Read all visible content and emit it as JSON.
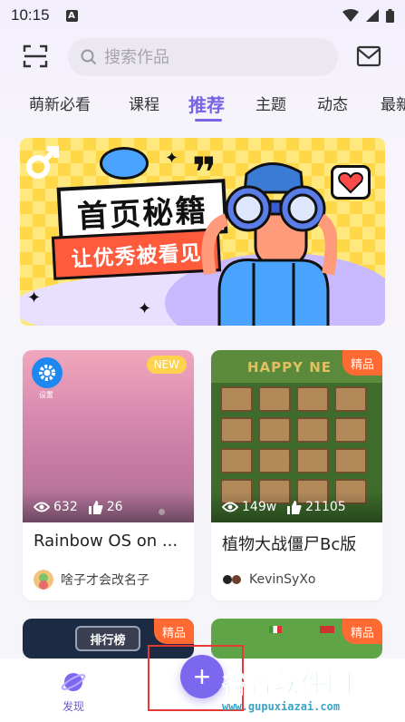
{
  "status_bar": {
    "time": "10:15",
    "indicator": "A",
    "icons": [
      "wifi-icon",
      "signal-icon",
      "battery-icon"
    ]
  },
  "top_bar": {
    "search_placeholder": "搜索作品",
    "icons": [
      "scan-icon",
      "search-icon",
      "mail-icon"
    ]
  },
  "tabs": [
    {
      "label": "萌新必看"
    },
    {
      "label": "课程"
    },
    {
      "label": "推荐",
      "active": true
    },
    {
      "label": "主题"
    },
    {
      "label": "动态"
    },
    {
      "label": "最新"
    }
  ],
  "banner": {
    "title": "首页秘籍",
    "subtitle": "让优秀被看见"
  },
  "cards": [
    {
      "badge": "NEW",
      "views": "632",
      "likes": "26",
      "title": "Rainbow OS on ...",
      "author": "啥子才会改名子",
      "app_icon_caption": "设置"
    },
    {
      "badge": "精品",
      "views": "149w",
      "likes": "21105",
      "title": "植物大战僵尸Bc版",
      "author": "KevinSyXo",
      "thumb_text": "HAPPY NE"
    },
    {
      "badge": "精品",
      "thumb_text": "排行榜"
    },
    {
      "badge": "精品"
    }
  ],
  "bottom_nav": {
    "discover_label": "发现",
    "fab_label": "+"
  },
  "watermark": {
    "main": "谷普软件园",
    "url": "www.gupuxiazai.com"
  },
  "colors": {
    "accent": "#7663e6",
    "badge_orange": "#ff6a33",
    "badge_new": "#ffd24d"
  }
}
